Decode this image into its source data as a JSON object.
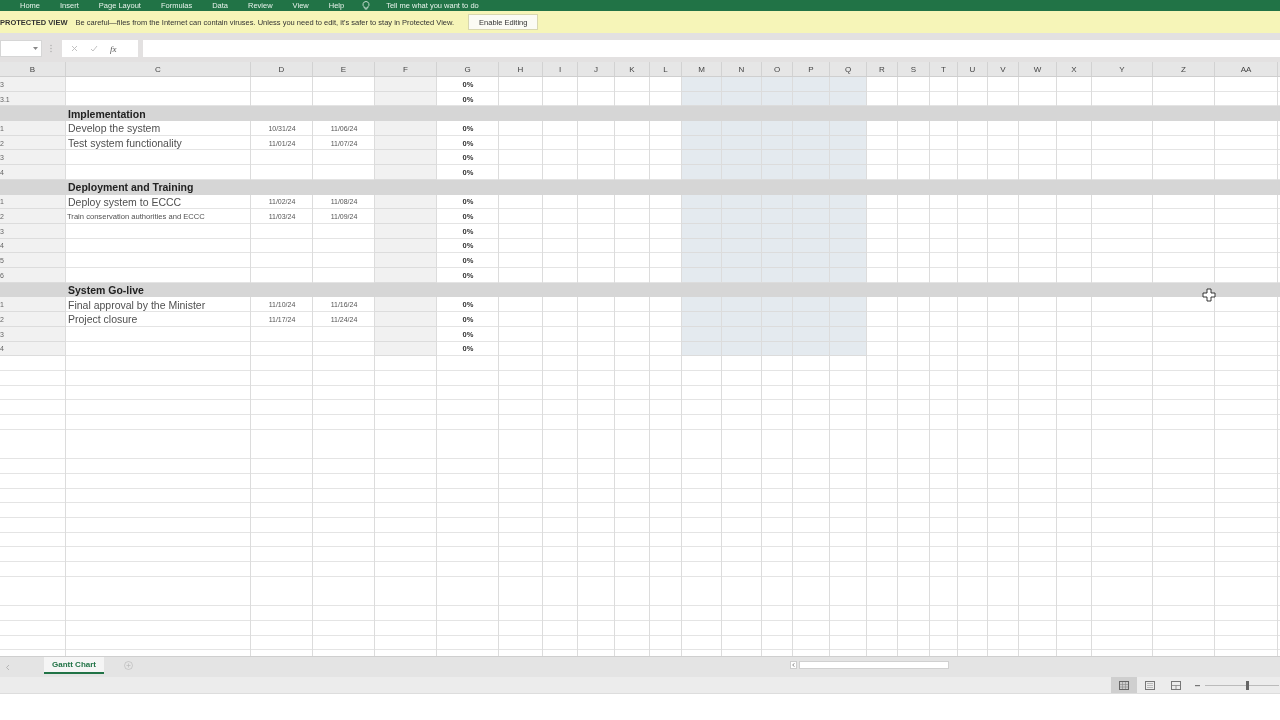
{
  "ribbon": {
    "tabs": [
      "Home",
      "Insert",
      "Page Layout",
      "Formulas",
      "Data",
      "Review",
      "View",
      "Help"
    ],
    "tell_me": "Tell me what you want to do"
  },
  "protected_view": {
    "label": "PROTECTED VIEW",
    "message": "Be careful—files from the Internet can contain viruses. Unless you need to edit, it's safer to stay in Protected View.",
    "button": "Enable Editing"
  },
  "formula_bar": {
    "function_label": "fx"
  },
  "columns": [
    {
      "name": "B",
      "band": false
    },
    {
      "name": "C",
      "band": false
    },
    {
      "name": "D",
      "band": false
    },
    {
      "name": "E",
      "band": false
    },
    {
      "name": "F",
      "band": false
    },
    {
      "name": "G",
      "band": false
    },
    {
      "name": "H",
      "band": false
    },
    {
      "name": "I",
      "band": false
    },
    {
      "name": "J",
      "band": false
    },
    {
      "name": "K",
      "band": false
    },
    {
      "name": "L",
      "band": false
    },
    {
      "name": "M",
      "band": true
    },
    {
      "name": "N",
      "band": true
    },
    {
      "name": "O",
      "band": true
    },
    {
      "name": "P",
      "band": true
    },
    {
      "name": "Q",
      "band": true
    },
    {
      "name": "R",
      "band": false
    },
    {
      "name": "S",
      "band": false
    },
    {
      "name": "T",
      "band": false
    },
    {
      "name": "U",
      "band": false
    },
    {
      "name": "V",
      "band": false
    },
    {
      "name": "W",
      "band": false
    },
    {
      "name": "X",
      "band": false
    },
    {
      "name": "Y",
      "band": false
    },
    {
      "name": "Z",
      "band": false
    },
    {
      "name": "AA",
      "band": false
    }
  ],
  "rows": [
    {
      "kind": "task",
      "wbs": "3",
      "progress": "0%"
    },
    {
      "kind": "task",
      "wbs": "3.1",
      "progress": "0%"
    },
    {
      "kind": "section",
      "title": "Implementation"
    },
    {
      "kind": "task",
      "wbs": "1",
      "name": "Develop the system",
      "start": "10/31/24",
      "end": "11/06/24",
      "progress": "0%"
    },
    {
      "kind": "task",
      "wbs": "2",
      "name": "Test system functionality",
      "start": "11/01/24",
      "end": "11/07/24",
      "progress": "0%"
    },
    {
      "kind": "task",
      "wbs": "3",
      "progress": "0%"
    },
    {
      "kind": "task",
      "wbs": "4",
      "progress": "0%"
    },
    {
      "kind": "section",
      "title": "Deployment and Training"
    },
    {
      "kind": "task",
      "wbs": "1",
      "name": "Deploy system to ECCC",
      "start": "11/02/24",
      "end": "11/08/24",
      "progress": "0%"
    },
    {
      "kind": "task",
      "wbs": "2",
      "name": "Train conservation authorities and ECCC",
      "shrink_to_fit": true,
      "start": "11/03/24",
      "end": "11/09/24",
      "progress": "0%"
    },
    {
      "kind": "task",
      "wbs": "3",
      "progress": "0%"
    },
    {
      "kind": "task",
      "wbs": "4",
      "progress": "0%"
    },
    {
      "kind": "task",
      "wbs": "5",
      "progress": "0%"
    },
    {
      "kind": "task",
      "wbs": "6",
      "progress": "0%"
    },
    {
      "kind": "section",
      "title": "System Go-live"
    },
    {
      "kind": "task",
      "wbs": "1",
      "name": "Final approval by the Minister",
      "start": "11/10/24",
      "end": "11/16/24",
      "progress": "0%"
    },
    {
      "kind": "task",
      "wbs": "2",
      "name": "Project closure",
      "start": "11/17/24",
      "end": "11/24/24",
      "progress": "0%"
    },
    {
      "kind": "task",
      "wbs": "3",
      "progress": "0%"
    },
    {
      "kind": "task",
      "wbs": "4",
      "progress": "0%"
    }
  ],
  "sheet_tabs": [
    {
      "label": "Gantt Chart",
      "selected": true
    }
  ],
  "status_bar": {
    "views": [
      {
        "kind": "normal",
        "selected": true
      },
      {
        "kind": "page-layout",
        "selected": false
      },
      {
        "kind": "page-break",
        "selected": false
      }
    ],
    "zoom": {
      "level": 0.55
    }
  }
}
